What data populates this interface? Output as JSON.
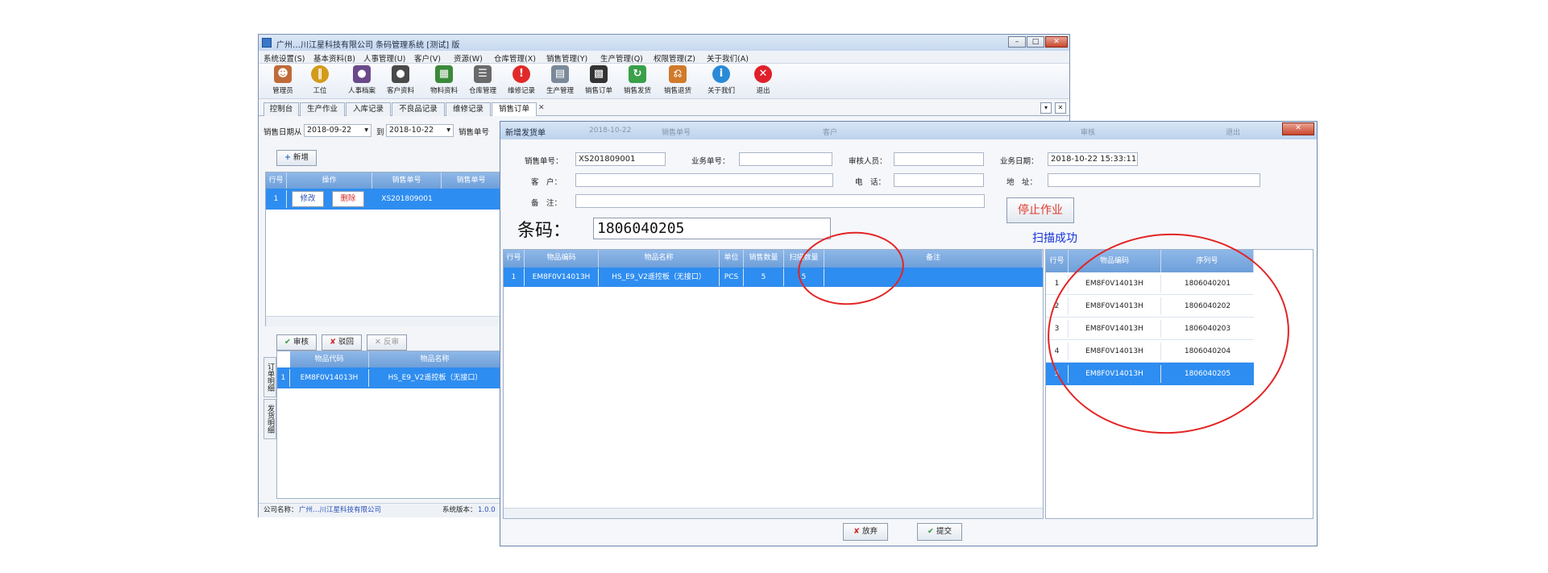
{
  "main_window": {
    "title": "广州…川江星科技有限公司 条码管理系统 [测试] 版",
    "menu": [
      "系统设置(S)",
      "基本资料(B)",
      "人事管理(U)",
      "客户(V)",
      "资源(W)",
      "仓库管理(X)",
      "销售管理(Y)",
      "生产管理(Q)",
      "权限管理(Z)",
      "关于我们(A)"
    ],
    "toolbar": [
      {
        "label": "管理员",
        "icon": "admin-icon",
        "color": "#c06a3a"
      },
      {
        "label": "工位",
        "icon": "station-icon",
        "color": "#d49a1a"
      },
      {
        "label": "人事档案",
        "icon": "personnel-icon",
        "color": "#6a4a8a"
      },
      {
        "label": "客户资料",
        "icon": "customer-icon",
        "color": "#4a4a4a"
      },
      {
        "label": "物料资料",
        "icon": "material-icon",
        "color": "#3a8a3a"
      },
      {
        "label": "仓库管理",
        "icon": "warehouse-icon",
        "color": "#6a6a6a"
      },
      {
        "label": "维修记录",
        "icon": "repair-icon",
        "color": "#e02a2a"
      },
      {
        "label": "生产管理",
        "icon": "production-icon",
        "color": "#7a8a9a"
      },
      {
        "label": "销售订单",
        "icon": "sales-order-icon",
        "color": "#333333"
      },
      {
        "label": "销售发货",
        "icon": "delivery-icon",
        "color": "#3aa04a"
      },
      {
        "label": "销售退货",
        "icon": "return-icon",
        "color": "#d07a2a"
      },
      {
        "label": "关于我们",
        "icon": "info-icon",
        "color": "#2a8ad8"
      },
      {
        "label": "退出",
        "icon": "exit-icon",
        "color": "#e0202a"
      }
    ],
    "tabs": [
      "控制台",
      "生产作业",
      "入库记录",
      "不良品记录",
      "维修记录",
      "销售订单"
    ],
    "filter": {
      "date_label": "销售日期从",
      "date_from": "2018-09-22",
      "to_label": "到",
      "date_to": "2018-10-22",
      "order_label": "销售单号"
    },
    "new_button": "新增",
    "grid": {
      "headers": [
        "行号",
        "操作",
        "销售单号",
        "销售单号"
      ],
      "rows": [
        {
          "line": "1",
          "edit": "修改",
          "delete": "删除",
          "order": "XS201809001"
        }
      ]
    },
    "bottom_buttons": {
      "approve": "审核",
      "reject": "驳回",
      "cancel": "反审"
    },
    "detail_tabs": [
      "订单明细",
      "发货明细"
    ],
    "detail_grid": {
      "headers": [
        "物品代码",
        "物品名称"
      ],
      "rows": [
        {
          "line": "1",
          "code": "EM8F0V14013H",
          "name": "HS_E9_V2遥控板（无接口）"
        }
      ]
    },
    "status": {
      "company_label": "公司名称：",
      "company": "广州…川江星科技有限公司",
      "version_label": "系统版本：",
      "version": "1.0.0"
    }
  },
  "dialog": {
    "title": "新增发货单",
    "ghost_text": [
      "2018-10-22",
      "销售单号",
      "客户",
      "审核",
      "退出"
    ],
    "fields": {
      "order_no_label": "销售单号：",
      "order_no": "XS201809001",
      "business_no_label": "业务单号：",
      "business_no": "",
      "handler_label": "审核人员：",
      "handler": "",
      "biz_date_label": "业务日期：",
      "biz_date": "2018-10-22 15:33:11",
      "customer_label": "客　户：",
      "customer": "",
      "phone_label": "电　话：",
      "phone": "",
      "address_label": "地　址：",
      "address": "",
      "remark_label": "备　注：",
      "remark": ""
    },
    "barcode_label": "条码：",
    "barcode": "1806040205",
    "stop_button": "停止作业",
    "scan_status": "扫描成功",
    "order_grid": {
      "headers": [
        "行号",
        "物品编码",
        "物品名称",
        "单位",
        "销售数量",
        "扫描数量",
        "备注"
      ],
      "rows": [
        {
          "line": "1",
          "code": "EM8F0V14013H",
          "name": "HS_E9_V2遥控板（无接口）",
          "unit": "PCS",
          "sales_qty": "5",
          "scan_qty": "5",
          "remark": ""
        }
      ]
    },
    "serial_grid": {
      "headers": [
        "行号",
        "物品编码",
        "序列号"
      ],
      "rows": [
        {
          "line": "1",
          "code": "EM8F0V14013H",
          "serial": "1806040201"
        },
        {
          "line": "2",
          "code": "EM8F0V14013H",
          "serial": "1806040202"
        },
        {
          "line": "3",
          "code": "EM8F0V14013H",
          "serial": "1806040203"
        },
        {
          "line": "4",
          "code": "EM8F0V14013H",
          "serial": "1806040204"
        },
        {
          "line": "5",
          "code": "EM8F0V14013H",
          "serial": "1806040205"
        }
      ]
    },
    "buttons": {
      "cancel": "放弃",
      "submit": "提交"
    }
  }
}
